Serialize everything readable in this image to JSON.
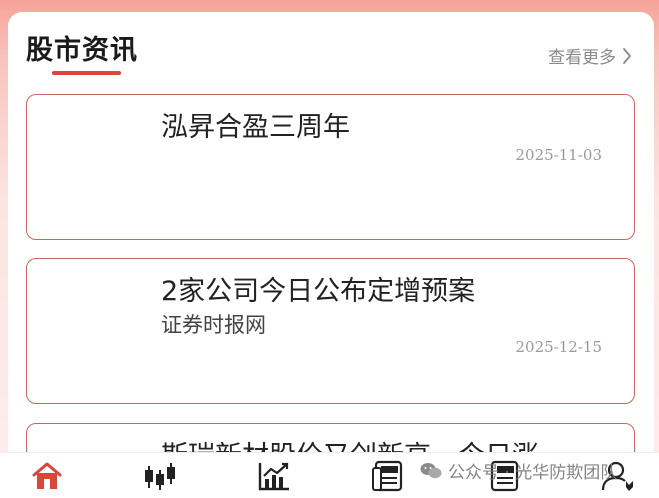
{
  "section": {
    "title": "股市资讯",
    "more_label": "查看更多"
  },
  "news": [
    {
      "title": "泓昇合盈三周年",
      "source": "",
      "date": "2025-11-03"
    },
    {
      "title": "2家公司今日公布定增预案",
      "source": "证券时报网",
      "date": "2025-12-15"
    },
    {
      "title": "斯瑞新材股价又创新高，今日涨",
      "source": "",
      "date": ""
    }
  ],
  "tabbar": {
    "tabs": [
      {
        "icon": "home-icon",
        "active": true
      },
      {
        "icon": "candlestick-icon",
        "active": false
      },
      {
        "icon": "trend-chart-icon",
        "active": false
      },
      {
        "icon": "news-icon",
        "active": false
      },
      {
        "icon": "news-list-icon",
        "active": false
      },
      {
        "icon": "user-icon",
        "active": false
      }
    ]
  },
  "watermark": {
    "text": "公众号 · 光华防欺团队"
  },
  "colors": {
    "accent": "#d9473a",
    "card_border": "#c8695e",
    "background_top": "#f5a39a"
  }
}
